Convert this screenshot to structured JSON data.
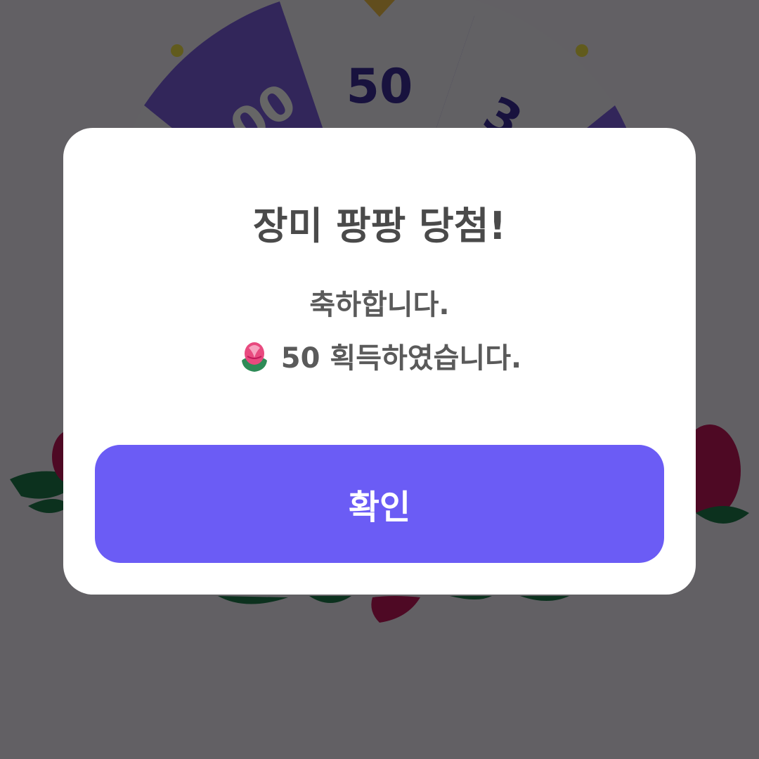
{
  "wheel": {
    "segment_values": [
      "50",
      "00",
      "3"
    ],
    "colors": {
      "ring": "#5b3fc4",
      "segment_purple": "#7e5fe0",
      "segment_light": "#f4f2fb",
      "number_text": "#3c2f9b",
      "rose": "#c2185b",
      "leaf": "#1f7a4d"
    }
  },
  "modal": {
    "title": "장미 팡팡 당첨!",
    "line1": "축하합니다.",
    "reward_icon": "rose-icon",
    "reward_amount": "50",
    "reward_suffix": "획득하였습니다.",
    "confirm_label": "확인",
    "colors": {
      "background": "#ffffff",
      "text": "#4a4a4a",
      "button": "#6b5cf5",
      "button_text": "#ffffff"
    }
  },
  "overlay": {
    "color": "#000000",
    "opacity": 0.6
  }
}
